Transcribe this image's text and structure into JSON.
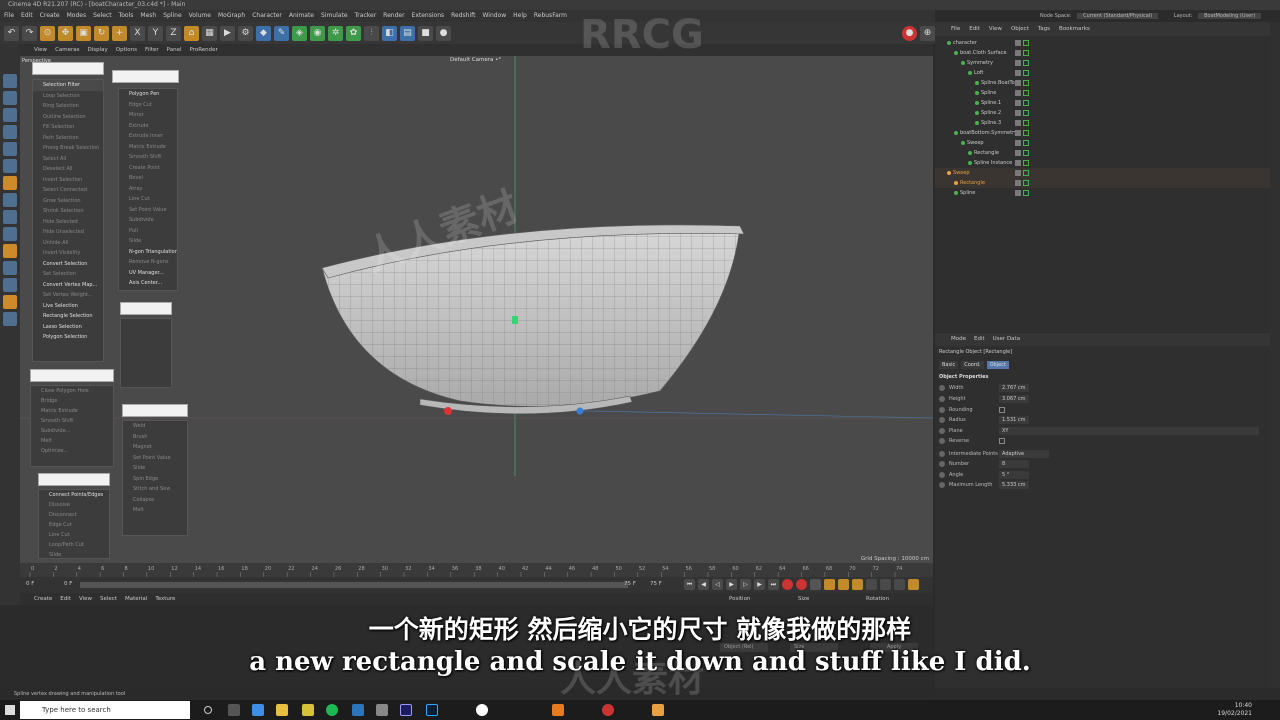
{
  "window": {
    "title": "Cinema 4D R21.207 (RC) - [boatCharacter_03.c4d *] - Main"
  },
  "menu": [
    "File",
    "Edit",
    "Create",
    "Modes",
    "Select",
    "Tools",
    "Mesh",
    "Spline",
    "Volume",
    "MoGraph",
    "Character",
    "Animate",
    "Simulate",
    "Tracker",
    "Render",
    "Extensions",
    "Redshift",
    "Window",
    "Help",
    "RebusFarm"
  ],
  "nodespace": {
    "label": "Node Space:",
    "value": "Current (Standard/Physical)",
    "layout_label": "Layout:",
    "layout_value": "BoatModeling (User)"
  },
  "viewport": {
    "menu": [
      "View",
      "Cameras",
      "Display",
      "Options",
      "Filter",
      "Panel",
      "ProRender"
    ],
    "camera": "Default Camera •°",
    "perspective": "Perspective",
    "grid_spacing": "Grid Spacing : 10000 cm",
    "left_panel": {
      "header": "Selection Filter",
      "items": [
        "Loop Selection",
        "Ring Selection",
        "Outline Selection",
        "Fill Selection",
        "Path Selection",
        "Phong Break Selection",
        "Select All",
        "Deselect All",
        "Invert Selection",
        "Select Connected",
        "Grow Selection",
        "Shrink Selection",
        "Hide Selected",
        "Hide Unselected",
        "Unhide All",
        "Invert Visibility",
        "Convert Selection",
        "Set Selection",
        "Convert Vertex Map...",
        "Set Vertex Weight...",
        "Live Selection",
        "Rectangle Selection",
        "Lasso Selection",
        "Polygon Selection"
      ],
      "highlight": [
        16,
        18,
        20,
        21,
        22,
        23
      ]
    },
    "mid_panel": {
      "items": [
        "Polygon Pen",
        "Edge Cut",
        "Mirror",
        "Extrude",
        "Extrude Inner",
        "Matrix Extrude",
        "Smooth Shift",
        "Create Point",
        "Bevel",
        "Array",
        "Line Cut",
        "Set Point Value",
        "Subdivide",
        "Pull",
        "Slide",
        "N-gon Triangulation",
        "Remove N-gons",
        "UV Manager...",
        "Axis Center..."
      ],
      "highlight": [
        0,
        15,
        17,
        18
      ]
    },
    "panel3": {
      "items": [
        "Close Polygon Hole",
        "Bridge",
        "Matrix Extrude",
        "Smooth Shift",
        "Subdivide...",
        "Melt",
        "Optimize..."
      ]
    },
    "panel4": {
      "items": [
        "Connect Points/Edges",
        "Dissolve",
        "Disconnect",
        "Edge Cut",
        "Line Cut",
        "Loop/Path Cut",
        "Slide"
      ],
      "highlight": [
        0
      ]
    },
    "panel5": {
      "items": [
        "Weld",
        "Brush",
        "Magnet",
        "Set Point Value",
        "Slide",
        "Spin Edge",
        "Stitch and Sew",
        "Collapse",
        "Melt"
      ]
    }
  },
  "timeline": {
    "ticks": [
      "0",
      "2",
      "4",
      "6",
      "8",
      "10",
      "12",
      "14",
      "16",
      "18",
      "20",
      "22",
      "24",
      "26",
      "28",
      "30",
      "32",
      "34",
      "36",
      "38",
      "40",
      "42",
      "44",
      "46",
      "48",
      "50",
      "52",
      "54",
      "56",
      "58",
      "60",
      "62",
      "64",
      "66",
      "68",
      "70",
      "72",
      "74"
    ],
    "start": "0 F",
    "current": "0 F",
    "end": "75 F",
    "end2": "75 F"
  },
  "material": {
    "menu": [
      "Create",
      "Edit",
      "View",
      "Select",
      "Material",
      "Texture"
    ]
  },
  "coords": {
    "headers": [
      "Position",
      "Size",
      "Rotation"
    ],
    "mode": "Object (Rel)",
    "size_mode": "Size",
    "apply": "Apply"
  },
  "status": "Spline vertex drawing and manipulation tool",
  "object_manager": {
    "menu": [
      "File",
      "Edit",
      "View",
      "Object",
      "Tags",
      "Bookmarks"
    ],
    "objects": [
      {
        "name": "character",
        "indent": 0,
        "color": "#ccc"
      },
      {
        "name": "boat.Cloth Surface",
        "indent": 1,
        "color": "#ccc"
      },
      {
        "name": "Symmetry",
        "indent": 2,
        "color": "#ccc"
      },
      {
        "name": "Loft",
        "indent": 3,
        "color": "#ccc"
      },
      {
        "name": "Spline.BoatTop",
        "indent": 4,
        "color": "#ccc"
      },
      {
        "name": "Spline",
        "indent": 4,
        "color": "#ccc"
      },
      {
        "name": "Spline.1",
        "indent": 4,
        "color": "#ccc"
      },
      {
        "name": "Spline.2",
        "indent": 4,
        "color": "#ccc"
      },
      {
        "name": "Spline.3",
        "indent": 4,
        "color": "#ccc"
      },
      {
        "name": "boatBottom.Symmetry",
        "indent": 1,
        "color": "#ccc"
      },
      {
        "name": "Sweep",
        "indent": 2,
        "color": "#ccc"
      },
      {
        "name": "Rectangle",
        "indent": 3,
        "color": "#ccc"
      },
      {
        "name": "Spline Instance",
        "indent": 3,
        "color": "#ccc"
      },
      {
        "name": "Sweep",
        "indent": 0,
        "color": "#e8a040"
      },
      {
        "name": "Rectangle",
        "indent": 1,
        "color": "#e8a040"
      },
      {
        "name": "Spline",
        "indent": 1,
        "color": "#ccc"
      }
    ]
  },
  "attributes": {
    "menu": [
      "Mode",
      "Edit",
      "User Data"
    ],
    "title": "Rectangle Object [Rectangle]",
    "tabs": [
      "Basic",
      "Coord.",
      "Object"
    ],
    "section": "Object Properties",
    "props": [
      {
        "label": "Width",
        "value": "2.767 cm"
      },
      {
        "label": "Height",
        "value": "3.067 cm"
      },
      {
        "label": "Rounding",
        "value": ""
      },
      {
        "label": "Radius",
        "value": "1.531 cm"
      },
      {
        "label": "Plane",
        "value": "XY"
      },
      {
        "label": "Reverse",
        "value": ""
      },
      {
        "label": "Intermediate Points",
        "value": "Adaptive"
      },
      {
        "label": "Number",
        "value": "8"
      },
      {
        "label": "Angle",
        "value": "5 °"
      },
      {
        "label": "Maximum Length",
        "value": "5.333 cm"
      }
    ]
  },
  "subtitles": {
    "cn": "一个新的矩形 然后缩小它的尺寸 就像我做的那样",
    "en": "a new rectangle and scale it down and stuff like I did."
  },
  "watermarks": [
    "RRCG",
    "人人素材"
  ],
  "taskbar": {
    "search_placeholder": "Type here to search",
    "time": "10:40",
    "date": "19/02/2021"
  },
  "colors": {
    "accent": "#e8a040",
    "green": "#4caf50",
    "viewport": "#4a4a4a"
  }
}
